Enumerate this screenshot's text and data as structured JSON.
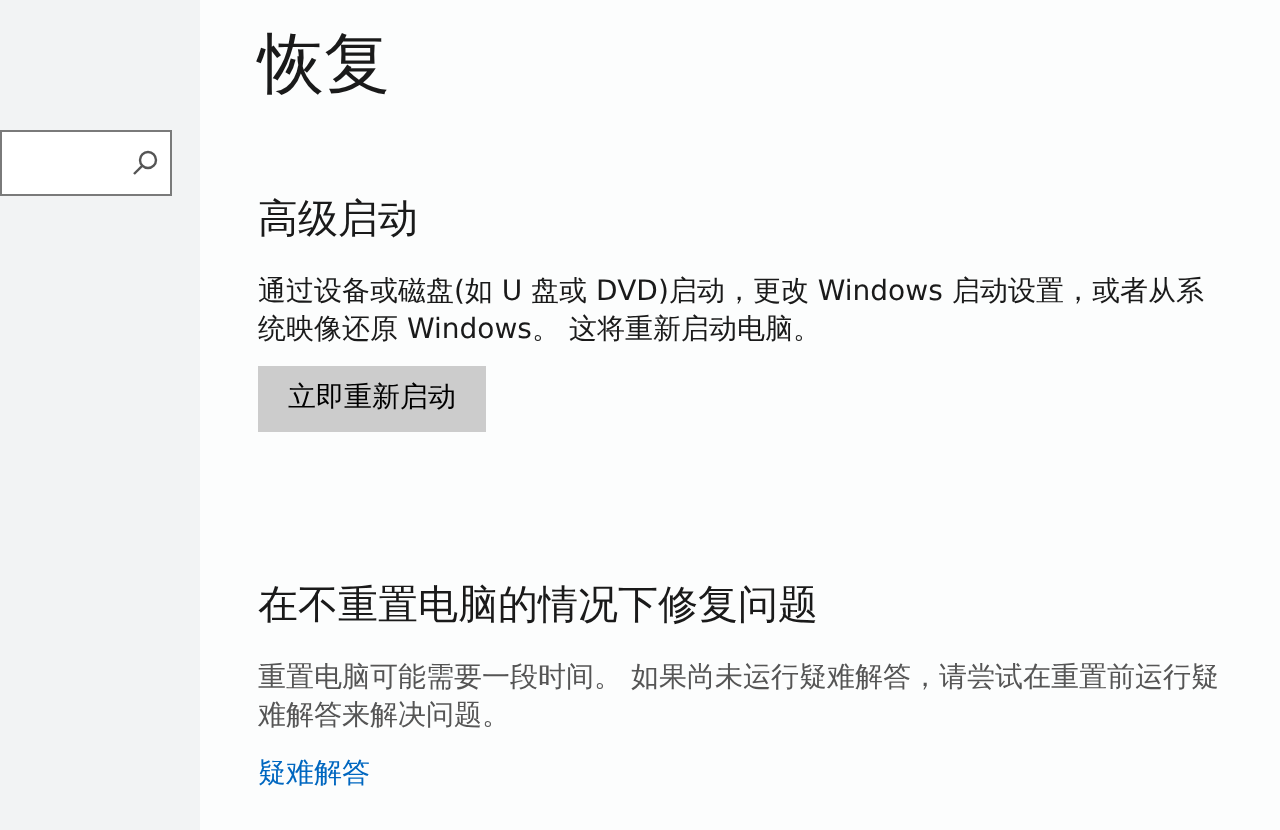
{
  "page_title": "恢复",
  "sections": [
    {
      "heading": "高级启动",
      "description": "通过设备或磁盘(如 U 盘或 DVD)启动，更改 Windows 启动设置，或者从系统映像还原 Windows。 这将重新启动电脑。",
      "action": {
        "kind": "button",
        "label": "立即重新启动"
      }
    },
    {
      "heading": "在不重置电脑的情况下修复问题",
      "description": "重置电脑可能需要一段时间。 如果尚未运行疑难解答，请尝试在重置前运行疑难解答来解决问题。",
      "action": {
        "kind": "link",
        "label": "疑难解答"
      }
    }
  ]
}
